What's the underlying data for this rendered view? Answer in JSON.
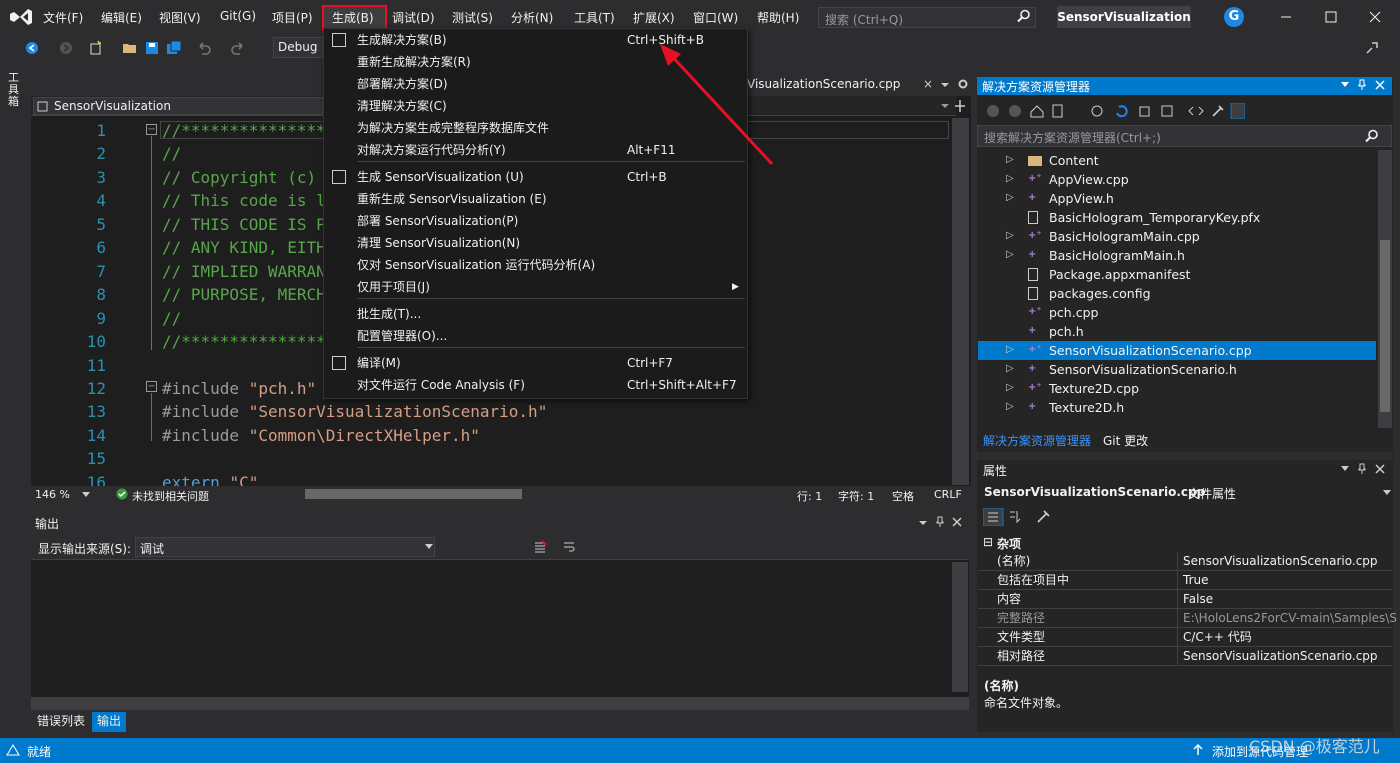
{
  "menubar": {
    "items": [
      "文件(F)",
      "编辑(E)",
      "视图(V)",
      "Git(G)",
      "项目(P)",
      "生成(B)",
      "调试(D)",
      "测试(S)",
      "分析(N)",
      "工具(T)",
      "扩展(X)",
      "窗口(W)",
      "帮助(H)"
    ],
    "active": "生成(B)"
  },
  "search": {
    "placeholder": "搜索 (Ctrl+Q)"
  },
  "app_title": "SensorVisualization",
  "avatar_letter": "G",
  "toolbar": {
    "config": "Debug"
  },
  "left_tabs": {
    "toolbox": "工具箱"
  },
  "doc_tab": {
    "label": "VisualizationScenario.cpp",
    "close": "×"
  },
  "navbar": {
    "project": "SensorVisualization"
  },
  "editor": {
    "line_numbers": [
      "1",
      "2",
      "3",
      "4",
      "5",
      "6",
      "7",
      "8",
      "9",
      "10",
      "11",
      "12",
      "13",
      "14",
      "15",
      "16"
    ],
    "lines": [
      {
        "cls": "cm",
        "text": "//***************"
      },
      {
        "cls": "cm",
        "text": "//"
      },
      {
        "cls": "cm",
        "text": "// Copyright (c) "
      },
      {
        "cls": "cm",
        "text": "// This code is l"
      },
      {
        "cls": "cm",
        "text": "// THIS CODE IS P"
      },
      {
        "cls": "cm",
        "text": "// ANY KIND, EITH"
      },
      {
        "cls": "cm",
        "text": "// IMPLIED WARRAN"
      },
      {
        "cls": "cm",
        "text": "// PURPOSE, MERCH"
      },
      {
        "cls": "cm",
        "text": "//"
      },
      {
        "cls": "cm",
        "text": "//***************"
      },
      {
        "cls": "",
        "text": ""
      },
      {
        "cls": "pp",
        "text": "#include ",
        "str": "\"pch.h\""
      },
      {
        "cls": "pp",
        "text": "#include ",
        "str": "\"SensorVisualizationScenario.h\""
      },
      {
        "cls": "pp",
        "text": "#include ",
        "str": "\"Common\\DirectXHelper.h\""
      },
      {
        "cls": "",
        "text": ""
      },
      {
        "cls": "kw",
        "text": "extern ",
        "str": "\"C\""
      }
    ]
  },
  "editor_status": {
    "zoom": "146 %",
    "issues": "未找到相关问题",
    "line": "行: 1",
    "col": "字符: 1",
    "ws": "空格",
    "eol": "CRLF"
  },
  "output": {
    "title": "输出",
    "source_label": "显示输出来源(S):",
    "source_value": "调试"
  },
  "bottom_tabs": [
    "错误列表",
    "输出"
  ],
  "status": {
    "ready": "就绪",
    "source_control": "添加到源代码管理",
    "watermark": "CSDN @极客范儿"
  },
  "solution_explorer": {
    "title": "解决方案资源管理器",
    "search_placeholder": "搜索解决方案资源管理器(Ctrl+;)",
    "items": [
      {
        "name": "Content",
        "expand": true,
        "icon": "folder"
      },
      {
        "name": "AppView.cpp",
        "expand": true,
        "icon": "cpp"
      },
      {
        "name": "AppView.h",
        "expand": true,
        "icon": "h"
      },
      {
        "name": "BasicHologram_TemporaryKey.pfx",
        "expand": false,
        "icon": "file"
      },
      {
        "name": "BasicHologramMain.cpp",
        "expand": true,
        "icon": "cpp"
      },
      {
        "name": "BasicHologramMain.h",
        "expand": true,
        "icon": "h"
      },
      {
        "name": "Package.appxmanifest",
        "expand": false,
        "icon": "file"
      },
      {
        "name": "packages.config",
        "expand": false,
        "icon": "file"
      },
      {
        "name": "pch.cpp",
        "expand": false,
        "icon": "cpp"
      },
      {
        "name": "pch.h",
        "expand": false,
        "icon": "h"
      },
      {
        "name": "SensorVisualizationScenario.cpp",
        "expand": true,
        "icon": "cpp",
        "selected": true
      },
      {
        "name": "SensorVisualizationScenario.h",
        "expand": true,
        "icon": "h"
      },
      {
        "name": "Texture2D.cpp",
        "expand": true,
        "icon": "cpp"
      },
      {
        "name": "Texture2D.h",
        "expand": true,
        "icon": "h"
      }
    ],
    "tabs": [
      "解决方案资源管理器",
      "Git 更改"
    ]
  },
  "properties": {
    "title": "属性",
    "object": "SensorVisualizationScenario.cpp",
    "object_type": "文件属性",
    "category": "杂项",
    "rows": [
      {
        "name": "(名称)",
        "value": "SensorVisualizationScenario.cpp"
      },
      {
        "name": "包括在项目中",
        "value": "True"
      },
      {
        "name": "内容",
        "value": "False"
      },
      {
        "name": "完整路径",
        "value": "E:\\HoloLens2ForCV-main\\Samples\\S",
        "dim": true
      },
      {
        "name": "文件类型",
        "value": "C/C++ 代码"
      },
      {
        "name": "相对路径",
        "value": "SensorVisualizationScenario.cpp"
      }
    ],
    "desc_title": "(名称)",
    "desc_text": "命名文件对象。"
  },
  "build_menu": {
    "items": [
      {
        "label": "生成解决方案(B)",
        "shortcut": "Ctrl+Shift+B",
        "icon": true
      },
      {
        "label": "重新生成解决方案(R)",
        "shortcut": ""
      },
      {
        "label": "部署解决方案(D)",
        "shortcut": ""
      },
      {
        "label": "清理解决方案(C)",
        "shortcut": ""
      },
      {
        "label": "为解决方案生成完整程序数据库文件",
        "shortcut": ""
      },
      {
        "label": "对解决方案运行代码分析(Y)",
        "shortcut": "Alt+F11"
      },
      {
        "label": "生成 SensorVisualization (U)",
        "shortcut": "Ctrl+B",
        "icon": true
      },
      {
        "label": "重新生成 SensorVisualization (E)",
        "shortcut": ""
      },
      {
        "label": "部署 SensorVisualization(P)",
        "shortcut": ""
      },
      {
        "label": "清理 SensorVisualization(N)",
        "shortcut": ""
      },
      {
        "label": "仅对 SensorVisualization 运行代码分析(A)",
        "shortcut": ""
      },
      {
        "label": "仅用于项目(J)",
        "shortcut": "",
        "submenu": true
      },
      {
        "label": "批生成(T)...",
        "shortcut": ""
      },
      {
        "label": "配置管理器(O)...",
        "shortcut": ""
      },
      {
        "label": "编译(M)",
        "shortcut": "Ctrl+F7",
        "icon": true
      },
      {
        "label": "对文件运行 Code Analysis (F)",
        "shortcut": "Ctrl+Shift+Alt+F7"
      }
    ]
  },
  "colors": {
    "accent": "#007acc",
    "highlight": "#e81123",
    "annotation_arrow": "#e81123"
  }
}
